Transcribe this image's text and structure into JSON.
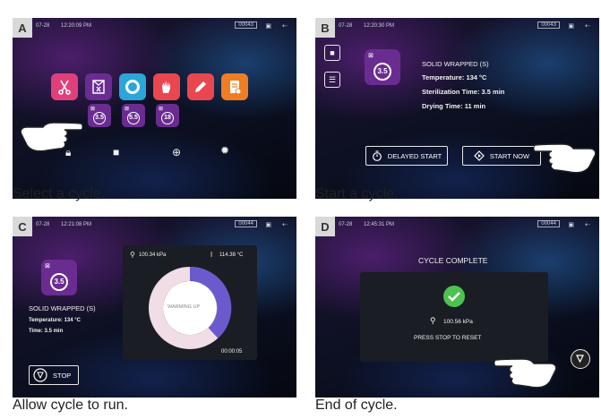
{
  "panels": {
    "a": {
      "letter": "A",
      "status": {
        "date": "07-28",
        "time": "12:20:09 PM",
        "counter": "00043"
      },
      "cycles": [
        "3.5",
        "5.5",
        "18"
      ],
      "caption": "Select a cycle."
    },
    "b": {
      "letter": "B",
      "status": {
        "date": "07-28",
        "time": "12:20:30 PM",
        "counter": "00043"
      },
      "cycle_num": "3.5",
      "cycle_name": "SOLID WRAPPED (S)",
      "temperature": "Temperature: 134 °C",
      "sterilization": "Sterilization Time: 3.5 min",
      "drying": "Drying Time: 11 min",
      "delayed_start": "DELAYED START",
      "start_now": "START NOW",
      "caption": "Start a cycle."
    },
    "c": {
      "letter": "C",
      "status": {
        "date": "07-28",
        "time": "12:21:08 PM",
        "counter": "00044"
      },
      "cycle_num": "3.5",
      "cycle_name": "SOLID WRAPPED (S)",
      "temperature": "Temperature: 134 °C",
      "time": "Time: 3.5 min",
      "pressure": "100.34 kPa",
      "temp_reading": "114.38 °C",
      "gauge_label": "WARMING UP",
      "elapsed": "00:00:05",
      "stop": "STOP",
      "caption": "Allow cycle to run."
    },
    "d": {
      "letter": "D",
      "status": {
        "date": "07-28",
        "time": "12:45:31 PM",
        "counter": "00044"
      },
      "title": "CYCLE COMPLETE",
      "pressure": "100.56 kPa",
      "message": "PRESS STOP TO RESET",
      "caption": "End of cycle."
    }
  },
  "colors": {
    "cycle_purple": "#6a2c91",
    "tile_colors": [
      "#e0407a",
      "#6a2c91",
      "#2aa6d8",
      "#e8474f",
      "#e8474f",
      "#f07d22"
    ],
    "check_green": "#4cc24f",
    "gauge_purple": "#6a5acd",
    "gauge_pink": "#f1dde6"
  }
}
